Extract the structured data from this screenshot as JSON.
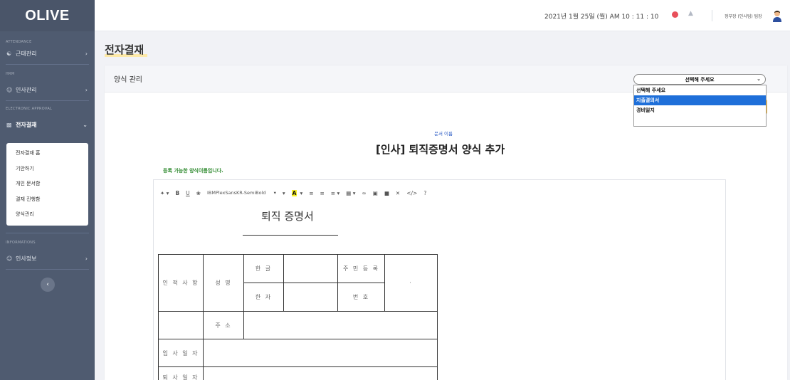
{
  "sidebar": {
    "logo": "OLIVE",
    "sections": [
      {
        "label": "ATTENDANCE",
        "item": "근태관리"
      },
      {
        "label": "HRM",
        "item": "인사관리"
      },
      {
        "label": "ELECTRONIC APPROVAL",
        "item": "전자결재"
      },
      {
        "label": "INFORMATIONS",
        "item": "인사정보"
      }
    ],
    "submenu": [
      "전자결재 홈",
      "기안하기",
      "개인 문서함",
      "결재 진행함",
      "양식관리"
    ],
    "collapse_icon": "chevron-left-icon"
  },
  "header": {
    "datetime": "2021년 1월 25일 (월) AM 10 : 11 : 10",
    "user": "정부장 (인사팀) 팀장"
  },
  "page": {
    "title": "전자결재",
    "card_title": "양식 관리"
  },
  "select": {
    "value": "선택해 주세요",
    "options": [
      "선택해 주세요",
      "지출결의서",
      "경비일지"
    ],
    "highlighted_index": 1
  },
  "document": {
    "label": "문서 이름",
    "name": "[인사] 퇴직증명서 양식 추가",
    "availability": "등록 가능한 양식이름입니다."
  },
  "editor": {
    "font": "IBMPlexSansKR-SemiBold",
    "heading": "퇴직 증명서",
    "table": {
      "personal": "인 적 사 항",
      "name": "성 명",
      "hangul": "한 글",
      "hanja": "한 자",
      "rrn_top": "주 민 등 록",
      "rrn_bottom": "번 호",
      "dot": "·",
      "address": "주 소",
      "join_date": "입 사 일 자",
      "leave_date": "퇴 사 일 자"
    }
  },
  "colors": {
    "sidebar": "#4f5b70",
    "accent_orange": "#f2b32c",
    "link_blue": "#2c5cc5",
    "success_green": "#2f8a2f",
    "dropdown_highlight": "#1e6fd9"
  }
}
